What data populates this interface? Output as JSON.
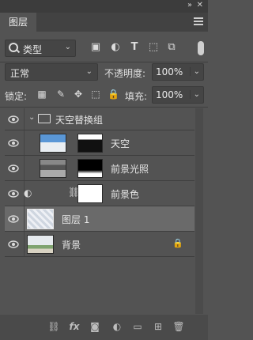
{
  "window": {
    "collapse_icon": "double-chevron-right-icon",
    "close_icon": "close-icon"
  },
  "tabs": {
    "active": "图层",
    "menu_icon": "panel-menu-icon"
  },
  "filter": {
    "kind": "类型"
  },
  "blend": {
    "mode": "正常",
    "opacity_label": "不透明度:",
    "opacity_value": "100%"
  },
  "lock": {
    "label": "锁定:",
    "fill_label": "填充:",
    "fill_value": "100%"
  },
  "layers": [
    {
      "name": "天空替换组",
      "type": "group"
    },
    {
      "name": "天空",
      "type": "layer"
    },
    {
      "name": "前景光照",
      "type": "layer"
    },
    {
      "name": "前景色",
      "type": "adjustment"
    },
    {
      "name": "图层 1",
      "type": "layer",
      "selected": true
    },
    {
      "name": "背景",
      "type": "background",
      "locked": true
    }
  ],
  "footer_icons": [
    "link-icon",
    "fx-icon",
    "mask-icon",
    "adjustment-icon",
    "folder-icon",
    "new-layer-icon",
    "trash-icon"
  ]
}
